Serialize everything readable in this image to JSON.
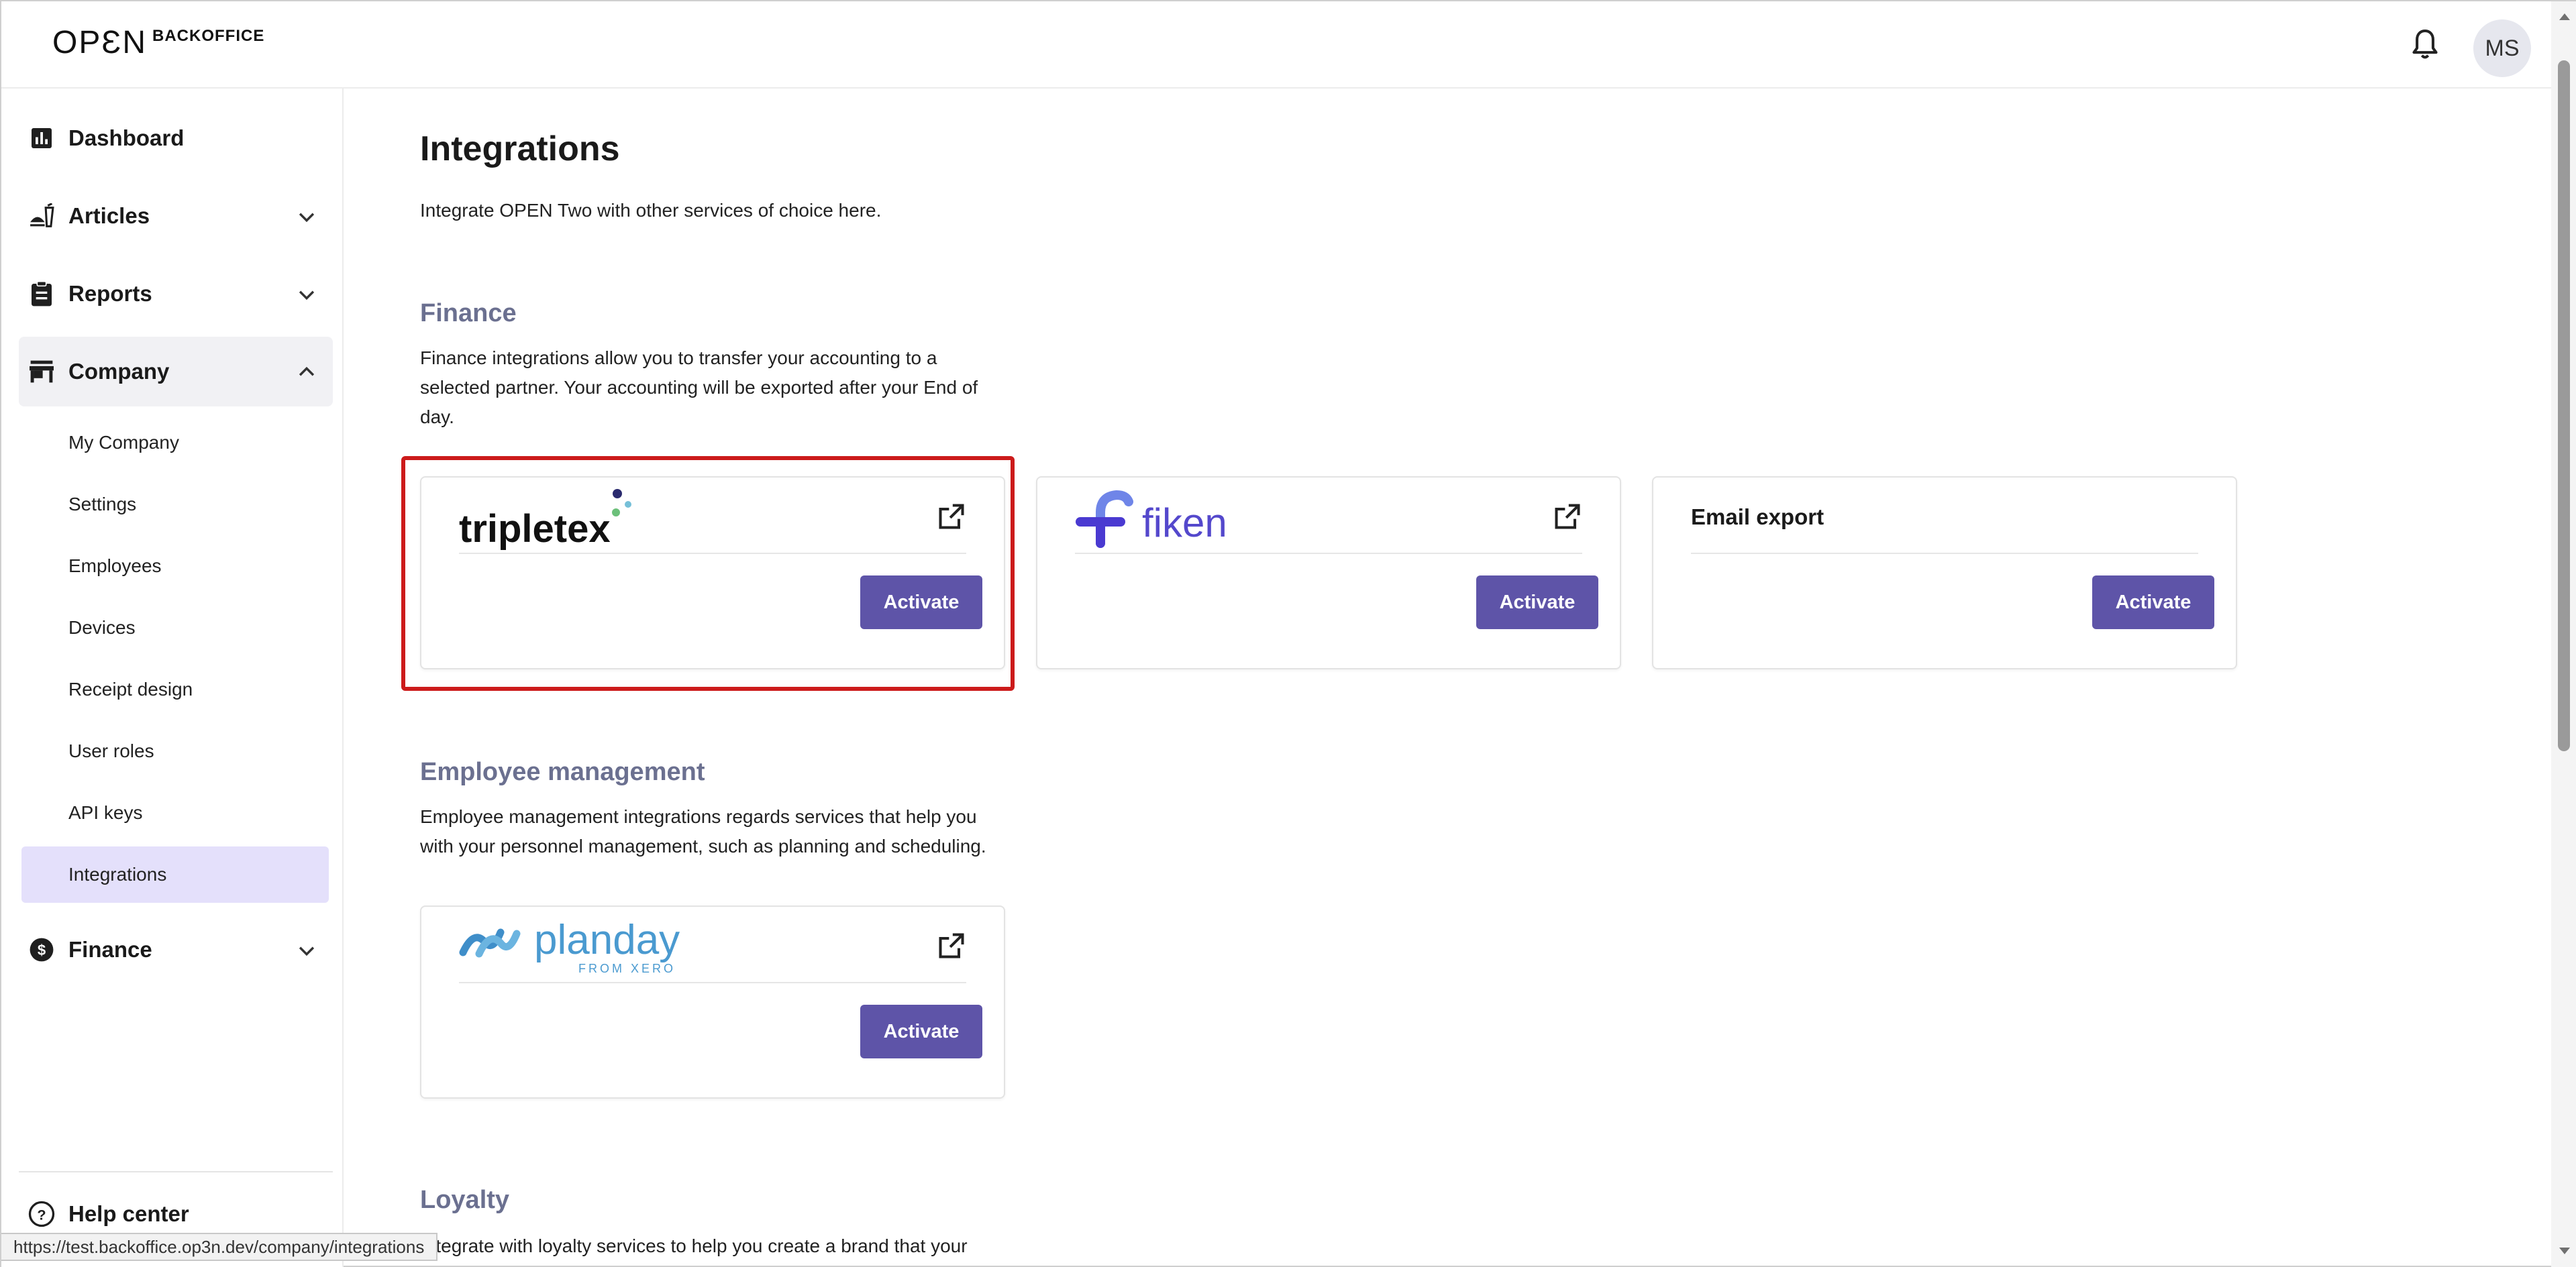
{
  "header": {
    "logo_main": "OPƐN",
    "logo_sub": "BACKOFFICE",
    "avatar_initials": "MS"
  },
  "sidebar": {
    "items": [
      {
        "label": "Dashboard",
        "icon": "bar-chart-icon"
      },
      {
        "label": "Articles",
        "icon": "food-icon"
      },
      {
        "label": "Reports",
        "icon": "clipboard-icon"
      },
      {
        "label": "Company",
        "icon": "store-icon"
      },
      {
        "label": "Finance",
        "icon": "dollar-icon"
      }
    ],
    "company_sub_items": [
      "My Company",
      "Settings",
      "Employees",
      "Devices",
      "Receipt design",
      "User roles",
      "API keys",
      "Integrations"
    ],
    "selected_sub_item": "Integrations",
    "help_label": "Help center"
  },
  "main": {
    "title": "Integrations",
    "subtitle": "Integrate OPEN Two with other services of choice here.",
    "sections": {
      "finance": {
        "title": "Finance",
        "description": "Finance integrations allow you to transfer your accounting to a selected partner. Your accounting will be exported after your End of day."
      },
      "employee": {
        "title": "Employee management",
        "description": "Employee management integrations regards services that help you with your personnel management, such as planning and scheduling."
      },
      "loyalty": {
        "title": "Loyalty",
        "description": "Integrate with loyalty services to help you create a brand that your"
      }
    },
    "cards": {
      "tripletex": {
        "name": "tripletex",
        "action": "Activate"
      },
      "fiken": {
        "name": "fiken",
        "action": "Activate"
      },
      "email": {
        "name": "Email export",
        "action": "Activate"
      },
      "planday": {
        "name": "planday",
        "tagline": "FROM XERO",
        "action": "Activate"
      }
    }
  },
  "status_bar": {
    "url": "https://test.backoffice.op3n.dev/company/integrations"
  },
  "colors": {
    "accent": "#5e54a8",
    "selected_bg": "#e4e0fb",
    "section_title": "#6b7090",
    "highlight": "#cc1b1b"
  }
}
